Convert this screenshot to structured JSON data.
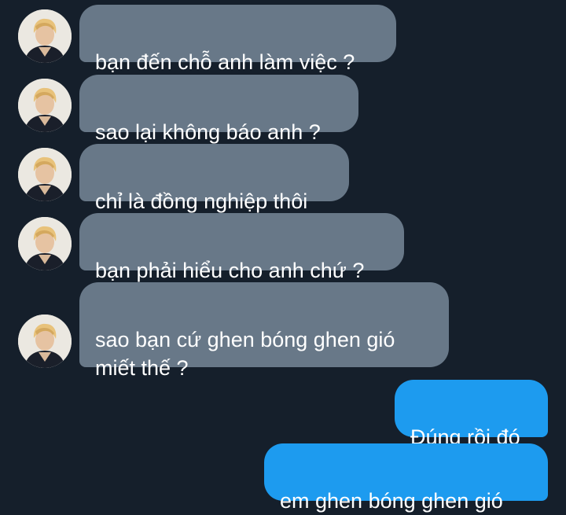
{
  "conversation": {
    "incoming": [
      {
        "text": "bạn đến chỗ anh làm việc ?"
      },
      {
        "text": "sao lại không báo anh ?"
      },
      {
        "text": "chỉ là đồng nghiệp thôi"
      },
      {
        "text": "bạn phải hiểu cho anh chứ ?"
      },
      {
        "text": "sao bạn cứ ghen bóng ghen gió\nmiết thế ?"
      }
    ],
    "outgoing": [
      {
        "text": "Đúng rồi đó"
      },
      {
        "text": "em ghen bóng ghen gió"
      }
    ]
  },
  "colors": {
    "background": "#151f2b",
    "incoming_bubble": "#687888",
    "outgoing_bubble": "#1d9bef",
    "text": "#ffffff"
  },
  "icons": {
    "avatar": "user-avatar"
  }
}
